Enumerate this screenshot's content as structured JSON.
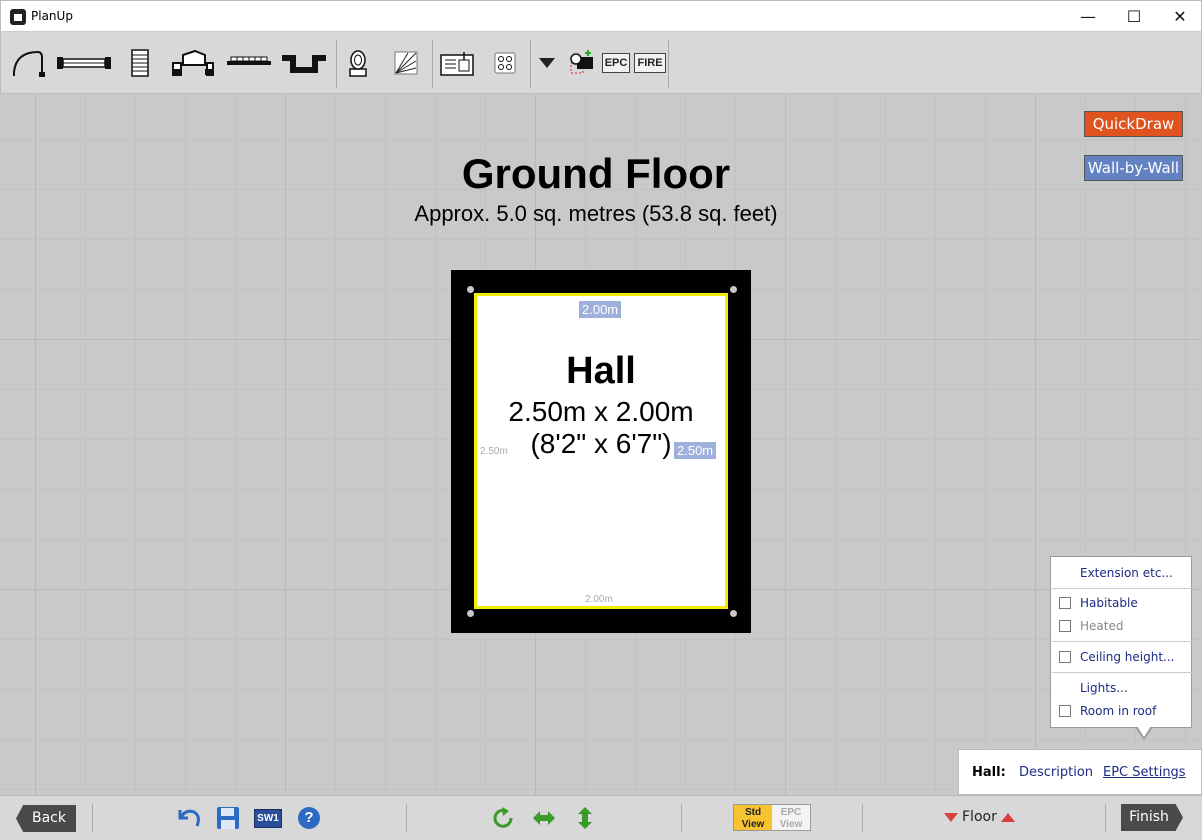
{
  "window": {
    "title": "PlanUp",
    "minimize_glyph": "—",
    "maximize_glyph": "☐",
    "close_glyph": "✕"
  },
  "toolbar": {
    "tools": [
      {
        "name": "door-arc-tool",
        "icon": "door-arc-icon"
      },
      {
        "name": "window-tool",
        "icon": "window-icon"
      },
      {
        "name": "stairs-tool",
        "icon": "stairs-icon"
      },
      {
        "name": "bay-window-tool",
        "icon": "bay-window-icon"
      },
      {
        "name": "radiator-tool",
        "icon": "radiator-icon"
      },
      {
        "name": "alcove-tool",
        "icon": "alcove-icon"
      },
      {
        "name": "toilet-tool",
        "icon": "toilet-icon"
      },
      {
        "name": "hatching-tool",
        "icon": "hatching-icon"
      },
      {
        "name": "label-tool",
        "icon": "label-icon"
      },
      {
        "name": "fixtures-tool",
        "icon": "fixtures-icon"
      },
      {
        "name": "more-dropdown",
        "icon": "triangle-down-icon"
      },
      {
        "name": "camera-tool",
        "icon": "camera-icon"
      }
    ],
    "epc_label": "EPC",
    "fire_label": "FIRE"
  },
  "canvas": {
    "floor_title": "Ground Floor",
    "floor_area": "Approx. 5.0 sq. metres (53.8 sq. feet)",
    "quickdraw_label": "QuickDraw",
    "wall_by_wall_label": "Wall-by-Wall",
    "room": {
      "name": "Hall",
      "dims_metric": "2.50m x 2.00m",
      "dims_imperial": "(8'2\" x 6'7\")",
      "dim_top": "2.00m",
      "dim_bottom": "2.00m",
      "dim_left": "2.50m",
      "dim_right": "2.50m"
    }
  },
  "popup": {
    "extension": "Extension etc...",
    "habitable": "Habitable",
    "heated": "Heated",
    "ceiling_height": "Ceiling height...",
    "lights": "Lights...",
    "room_in_roof": "Room in roof"
  },
  "room_panel": {
    "room_label": "Hall:",
    "description_link": "Description",
    "epc_settings_link": "EPC Settings"
  },
  "bottombar": {
    "back_label": "Back",
    "sw_label": "SW1",
    "help_glyph": "?",
    "std_view_line1": "Std",
    "std_view_line2": "View",
    "epc_view_line1": "EPC",
    "epc_view_line2": "View",
    "floor_label": "Floor",
    "finish_label": "Finish"
  },
  "colors": {
    "quickdraw": "#e0521e",
    "wall_by_wall": "#6382c3",
    "room_border": "#f2ec00",
    "link": "#1d2b82",
    "std_view": "#f6c430"
  }
}
